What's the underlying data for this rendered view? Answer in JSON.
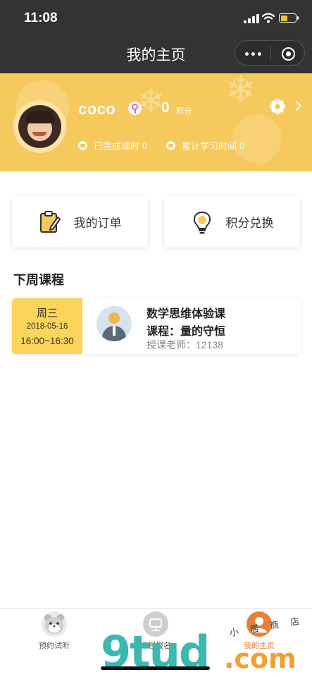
{
  "status_bar": {
    "time": "11:08"
  },
  "nav": {
    "title": "我的主页"
  },
  "profile": {
    "username": "coco",
    "points": "0",
    "points_label": "积分",
    "completed_label": "已完成课时",
    "completed_value": "0",
    "study_time_label": "累计学习时间",
    "study_time_value": "0"
  },
  "quick_actions": [
    {
      "label": "我的订单",
      "icon": "clipboard-icon"
    },
    {
      "label": "积分兑换",
      "icon": "lightbulb-icon"
    }
  ],
  "section": {
    "title": "下周课程"
  },
  "course": {
    "weekday": "周三",
    "date": "2018-05-16",
    "time": "16:00~16:30",
    "name": "数学思维体验课",
    "topic": "课程：量的守恒",
    "teacher": "授课老师：12138"
  },
  "tabs": [
    {
      "label": "预约试听",
      "icon": "hamster-icon",
      "active": false
    },
    {
      "label": "课程报名",
      "icon": "course-icon",
      "active": false
    },
    {
      "label": "我的主页",
      "icon": "profile-icon",
      "active": true
    }
  ],
  "watermark": {
    "brand": "9tud",
    "domain": ".com",
    "tag": "小 居 商 店"
  },
  "colors": {
    "accent": "#f6c95c",
    "date_block": "#fbd55a",
    "active_tab": "#e8803a"
  }
}
